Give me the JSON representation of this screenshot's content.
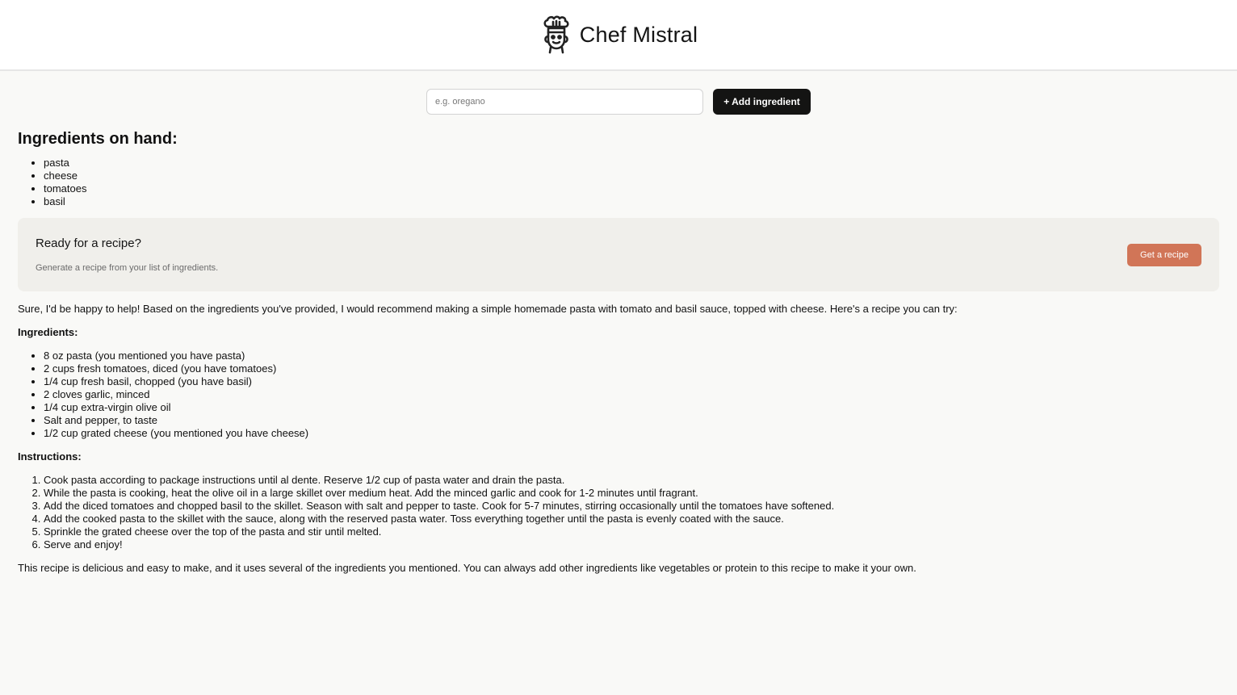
{
  "header": {
    "title": "Chef Mistral",
    "logo_icon": "chef-face-icon"
  },
  "form": {
    "placeholder": "e.g. oregano",
    "button_label": "+ Add ingredient"
  },
  "ingredients": {
    "heading": "Ingredients on hand:",
    "items": [
      "pasta",
      "cheese",
      "tomatoes",
      "basil"
    ]
  },
  "cta": {
    "title": "Ready for a recipe?",
    "subtitle": "Generate a recipe from your list of ingredients.",
    "button_label": "Get a recipe",
    "accent": "#d17557"
  },
  "recipe": {
    "intro": "Sure, I'd be happy to help! Based on the ingredients you've provided, I would recommend making a simple homemade pasta with tomato and basil sauce, topped with cheese. Here's a recipe you can try:",
    "ingredients_heading": "Ingredients:",
    "ingredients": [
      "8 oz pasta (you mentioned you have pasta)",
      "2 cups fresh tomatoes, diced (you have tomatoes)",
      "1/4 cup fresh basil, chopped (you have basil)",
      "2 cloves garlic, minced",
      "1/4 cup extra-virgin olive oil",
      "Salt and pepper, to taste",
      "1/2 cup grated cheese (you mentioned you have cheese)"
    ],
    "instructions_heading": "Instructions:",
    "instructions": [
      "Cook pasta according to package instructions until al dente. Reserve 1/2 cup of pasta water and drain the pasta.",
      "While the pasta is cooking, heat the olive oil in a large skillet over medium heat. Add the minced garlic and cook for 1-2 minutes until fragrant.",
      "Add the diced tomatoes and chopped basil to the skillet. Season with salt and pepper to taste. Cook for 5-7 minutes, stirring occasionally until the tomatoes have softened.",
      "Add the cooked pasta to the skillet with the sauce, along with the reserved pasta water. Toss everything together until the pasta is evenly coated with the sauce.",
      "Sprinkle the grated cheese over the top of the pasta and stir until melted.",
      "Serve and enjoy!"
    ],
    "outro": "This recipe is delicious and easy to make, and it uses several of the ingredients you mentioned. You can always add other ingredients like vegetables or protein to this recipe to make it your own."
  }
}
